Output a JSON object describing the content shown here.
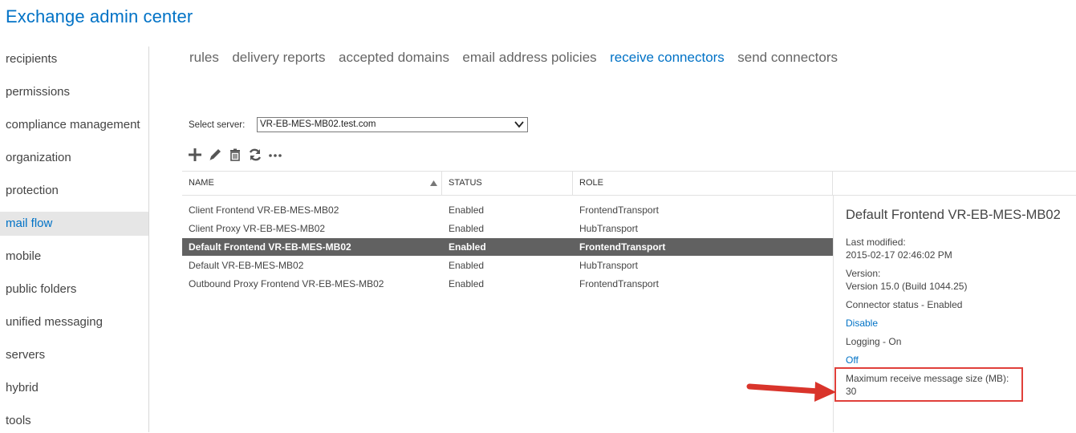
{
  "app": {
    "title": "Exchange admin center"
  },
  "sidebar": {
    "items": [
      {
        "label": "recipients"
      },
      {
        "label": "permissions"
      },
      {
        "label": "compliance management"
      },
      {
        "label": "organization"
      },
      {
        "label": "protection"
      },
      {
        "label": "mail flow",
        "active": true
      },
      {
        "label": "mobile"
      },
      {
        "label": "public folders"
      },
      {
        "label": "unified messaging"
      },
      {
        "label": "servers"
      },
      {
        "label": "hybrid"
      },
      {
        "label": "tools"
      }
    ]
  },
  "tabs": [
    {
      "label": "rules"
    },
    {
      "label": "delivery reports"
    },
    {
      "label": "accepted domains"
    },
    {
      "label": "email address policies"
    },
    {
      "label": "receive connectors",
      "active": true
    },
    {
      "label": "send connectors"
    }
  ],
  "server": {
    "label": "Select server:",
    "value": "VR-EB-MES-MB02.test.com"
  },
  "toolbar": {
    "icons": [
      "add-icon",
      "edit-icon",
      "delete-icon",
      "refresh-icon",
      "more-icon"
    ]
  },
  "table": {
    "columns": [
      "NAME",
      "STATUS",
      "ROLE"
    ],
    "rows": [
      {
        "name": "Client Frontend VR-EB-MES-MB02",
        "status": "Enabled",
        "role": "FrontendTransport"
      },
      {
        "name": "Client Proxy VR-EB-MES-MB02",
        "status": "Enabled",
        "role": "HubTransport"
      },
      {
        "name": "Default Frontend VR-EB-MES-MB02",
        "status": "Enabled",
        "role": "FrontendTransport",
        "selected": true
      },
      {
        "name": "Default VR-EB-MES-MB02",
        "status": "Enabled",
        "role": "HubTransport"
      },
      {
        "name": "Outbound Proxy Frontend VR-EB-MES-MB02",
        "status": "Enabled",
        "role": "FrontendTransport"
      }
    ]
  },
  "details": {
    "title": "Default Frontend VR-EB-MES-MB02",
    "last_modified_label": "Last modified:",
    "last_modified_value": "2015-02-17 02:46:02 PM",
    "version_label": "Version:",
    "version_value": "Version 15.0 (Build 1044.25)",
    "connector_status": "Connector status - Enabled",
    "disable_link": "Disable",
    "logging": "Logging - On",
    "off_link": "Off",
    "max_size_label": "Maximum receive message size (MB):",
    "max_size_value": "30"
  },
  "colors": {
    "accent": "#0072c6",
    "selected_row": "#616161",
    "annotation": "#e0403a"
  }
}
